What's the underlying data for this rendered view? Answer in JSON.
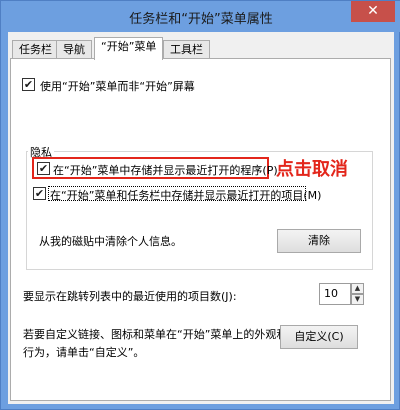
{
  "window": {
    "title": "任务栏和“开始”菜单属性",
    "close_glyph": "✕"
  },
  "tabs": [
    {
      "label": "任务栏"
    },
    {
      "label": "导航"
    },
    {
      "label": "“开始”菜单"
    },
    {
      "label": "工具栏"
    }
  ],
  "start_screen_option": {
    "label": "使用“开始”菜单而非“开始”屏幕",
    "checked": true
  },
  "privacy": {
    "group_title": "隐私",
    "store_programs": {
      "label": "在“开始”菜单中存储并显示最近打开的程序(P)",
      "checked": true
    },
    "store_items": {
      "label": "在“开始”菜单和任务栏中存储并显示最近打开的项目(M)",
      "checked": true
    },
    "clear_text": "从我的磁贴中清除个人信息。",
    "clear_button": "清除"
  },
  "annotation": {
    "text": "点击取消",
    "color": "#e3261b"
  },
  "recent_items": {
    "label": "要显示在跳转列表中的最近使用的项目数(J):",
    "value": "10"
  },
  "customize": {
    "text_line1": "若要自定义链接、图标和菜单在“开始”菜单上的外观和",
    "text_line2": "行为，请单击“自定义”。",
    "button": "自定义(C)"
  },
  "check_glyph": "✔"
}
